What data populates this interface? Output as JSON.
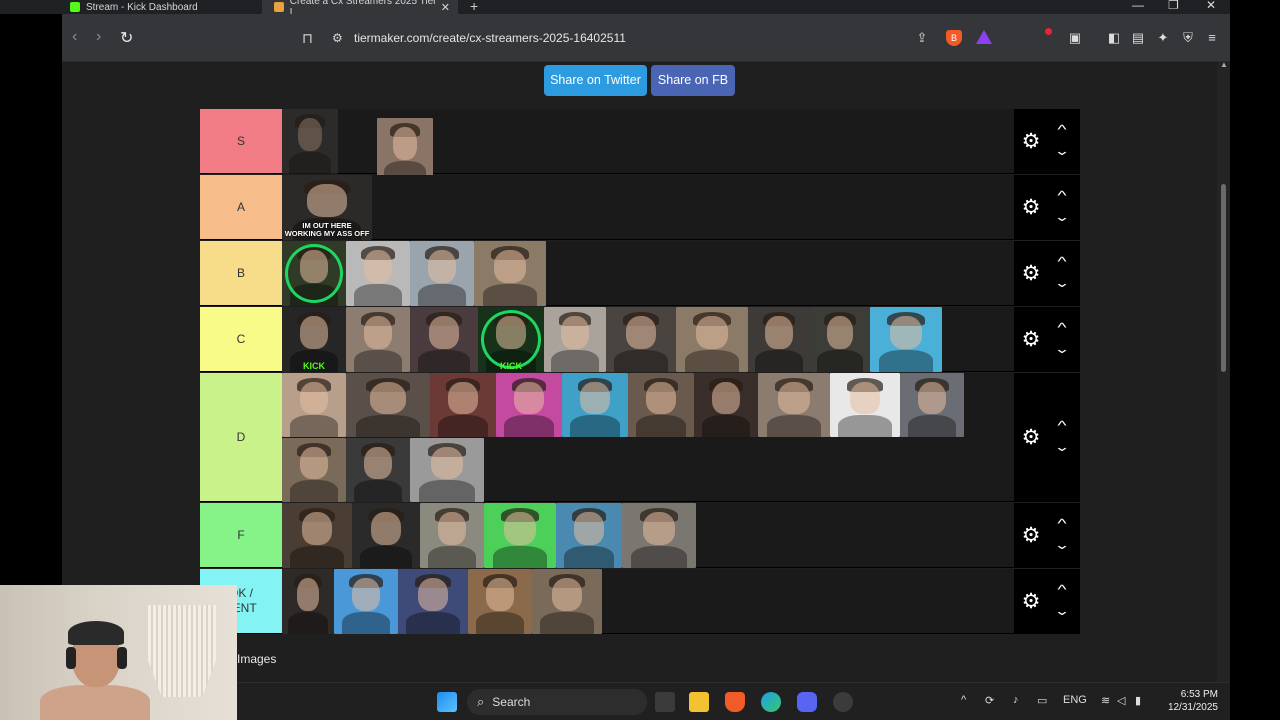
{
  "browser": {
    "tabs": [
      {
        "title": "Stream - Kick Dashboard"
      },
      {
        "title": "Create a Cx Streamers 2025 Tier L"
      }
    ],
    "url": "tiermaker.com/create/cx-streamers-2025-16402511"
  },
  "page": {
    "share_twitter": "Share on Twitter",
    "share_fb": "Share on FB",
    "images_label": "Images"
  },
  "tiers": [
    {
      "label": "S",
      "color": "#f17c86"
    },
    {
      "label": "A",
      "color": "#f6bd8b"
    },
    {
      "label": "B",
      "color": "#f7dc89"
    },
    {
      "label": "C",
      "color": "#f8fb87"
    },
    {
      "label": "D",
      "color": "#c9f38a"
    },
    {
      "label": "F",
      "color": "#86f388"
    },
    {
      "label": "OK / \nTENT",
      "color": "#84f3f3"
    }
  ],
  "item_captions": {
    "a1": "IM OUT HERE\nWORKING MY ASS OFF",
    "kick1": "KICK",
    "kick2": "KICK"
  },
  "taskbar": {
    "search_label": "Search",
    "lang": "ENG",
    "time": "6:53 PM",
    "date": "12/31/2025"
  }
}
